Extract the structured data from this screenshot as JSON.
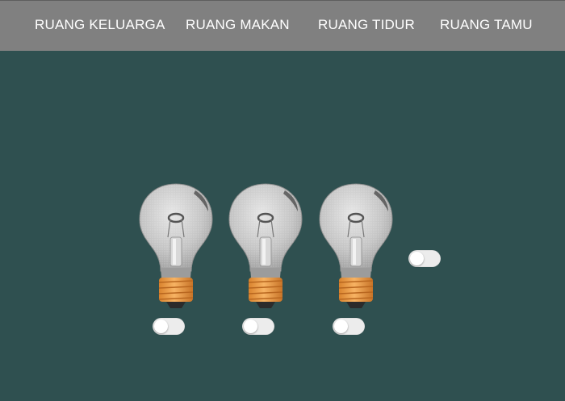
{
  "nav": {
    "items": [
      {
        "label": "RUANG KELUARGA"
      },
      {
        "label": "RUANG MAKAN"
      },
      {
        "label": "RUANG TIDUR"
      },
      {
        "label": "RUANG TAMU"
      }
    ]
  },
  "lamps": [
    {
      "icon": "lightbulb-icon",
      "on": false
    },
    {
      "icon": "lightbulb-icon",
      "on": false
    },
    {
      "icon": "lightbulb-icon",
      "on": false
    }
  ],
  "extra_switch": {
    "on": false
  },
  "colors": {
    "background": "#2f5050",
    "navbar": "#808080",
    "bulb_glass": "#cfcfcf",
    "bulb_base": "#f0a04a",
    "toggle_track": "#ececec"
  }
}
